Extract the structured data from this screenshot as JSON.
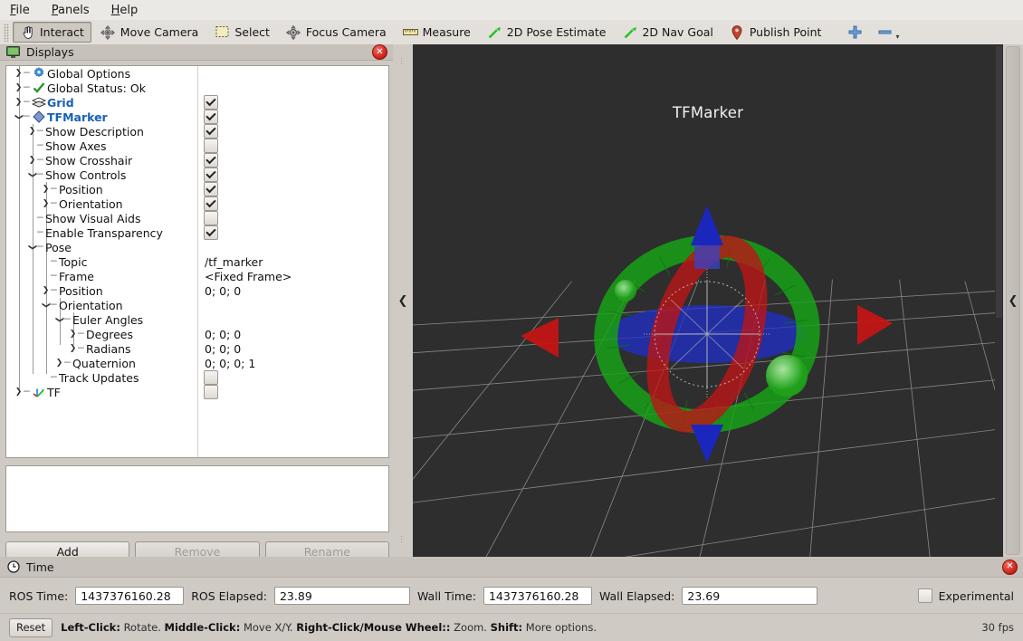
{
  "menubar": {
    "items": [
      {
        "name": "file",
        "label": "File",
        "mnemonic": "F"
      },
      {
        "name": "panels",
        "label": "Panels",
        "mnemonic": "P"
      },
      {
        "name": "help",
        "label": "Help",
        "mnemonic": "H"
      }
    ]
  },
  "toolbar": {
    "items": [
      {
        "name": "interact",
        "label": "Interact",
        "icon": "hand-cursor-icon",
        "active": true
      },
      {
        "name": "move-camera",
        "label": "Move Camera",
        "icon": "move-camera-icon",
        "active": false
      },
      {
        "name": "select",
        "label": "Select",
        "icon": "selection-rect-icon",
        "active": false
      },
      {
        "name": "focus-camera",
        "label": "Focus Camera",
        "icon": "focus-camera-icon",
        "active": false
      },
      {
        "name": "measure",
        "label": "Measure",
        "icon": "ruler-icon",
        "active": false
      },
      {
        "name": "2d-pose-estimate",
        "label": "2D Pose Estimate",
        "icon": "green-arrow-icon",
        "active": false
      },
      {
        "name": "2d-nav-goal",
        "label": "2D Nav Goal",
        "icon": "green-arrow-icon",
        "active": false
      },
      {
        "name": "publish-point",
        "label": "Publish Point",
        "icon": "map-pin-icon",
        "active": false
      }
    ],
    "add_tool_icon": "plus-icon",
    "remove_tool_icon": "minus-icon",
    "remove_tool_chevron": "chevron-down-icon"
  },
  "displays": {
    "title": "Displays",
    "close_icon": "close-icon",
    "panel_icon": "monitor-icon",
    "tree": [
      {
        "name": "global-options",
        "label": "Global Options",
        "indent": 0,
        "arrow": "collapsed",
        "icon": "gear-icon",
        "style": "normal",
        "check": null,
        "value": null
      },
      {
        "name": "global-status",
        "label": "Global Status: Ok",
        "indent": 0,
        "arrow": "collapsed",
        "icon": "check-icon",
        "style": "normal",
        "check": null,
        "value": null
      },
      {
        "name": "grid",
        "label": "Grid",
        "indent": 0,
        "arrow": "collapsed",
        "icon": "grid-icon",
        "style": "blue-bold",
        "check": true,
        "value": null
      },
      {
        "name": "tfmarker",
        "label": "TFMarker",
        "indent": 0,
        "arrow": "expanded",
        "icon": "diamond-icon",
        "style": "blue-bold",
        "check": true,
        "value": null
      },
      {
        "name": "show-description",
        "label": "Show Description",
        "indent": 1,
        "arrow": "collapsed",
        "icon": null,
        "style": "normal",
        "check": true,
        "value": null
      },
      {
        "name": "show-axes",
        "label": "Show Axes",
        "indent": 1,
        "arrow": "none",
        "icon": null,
        "style": "normal",
        "check": false,
        "value": null
      },
      {
        "name": "show-crosshair",
        "label": "Show Crosshair",
        "indent": 1,
        "arrow": "collapsed",
        "icon": null,
        "style": "normal",
        "check": true,
        "value": null
      },
      {
        "name": "show-controls",
        "label": "Show Controls",
        "indent": 1,
        "arrow": "expanded",
        "icon": null,
        "style": "normal",
        "check": true,
        "value": null
      },
      {
        "name": "position",
        "label": "Position",
        "indent": 2,
        "arrow": "collapsed",
        "icon": null,
        "style": "normal",
        "check": true,
        "value": null
      },
      {
        "name": "orientation",
        "label": "Orientation",
        "indent": 2,
        "arrow": "collapsed",
        "icon": null,
        "style": "normal",
        "check": true,
        "value": null
      },
      {
        "name": "show-visual-aids",
        "label": "Show Visual Aids",
        "indent": 1,
        "arrow": "none",
        "icon": null,
        "style": "normal",
        "check": false,
        "value": null
      },
      {
        "name": "enable-transparency",
        "label": "Enable Transparency",
        "indent": 1,
        "arrow": "none",
        "icon": null,
        "style": "normal",
        "check": true,
        "value": null
      },
      {
        "name": "pose",
        "label": "Pose",
        "indent": 1,
        "arrow": "expanded",
        "icon": null,
        "style": "normal",
        "check": null,
        "value": null
      },
      {
        "name": "topic",
        "label": "Topic",
        "indent": 2,
        "arrow": "none",
        "icon": null,
        "style": "normal",
        "check": null,
        "value": "/tf_marker"
      },
      {
        "name": "frame",
        "label": "Frame",
        "indent": 2,
        "arrow": "none",
        "icon": null,
        "style": "normal",
        "check": null,
        "value": "<Fixed Frame>"
      },
      {
        "name": "pose-position",
        "label": "Position",
        "indent": 2,
        "arrow": "collapsed",
        "icon": null,
        "style": "normal",
        "check": null,
        "value": "0; 0; 0"
      },
      {
        "name": "pose-orientation",
        "label": "Orientation",
        "indent": 2,
        "arrow": "expanded",
        "icon": null,
        "style": "normal",
        "check": null,
        "value": null
      },
      {
        "name": "euler-angles",
        "label": "Euler Angles",
        "indent": 3,
        "arrow": "expanded",
        "icon": null,
        "style": "normal",
        "check": null,
        "value": null
      },
      {
        "name": "degrees",
        "label": "Degrees",
        "indent": 4,
        "arrow": "collapsed",
        "icon": null,
        "style": "normal",
        "check": null,
        "value": "0; 0; 0"
      },
      {
        "name": "radians",
        "label": "Radians",
        "indent": 4,
        "arrow": "collapsed",
        "icon": null,
        "style": "normal",
        "check": null,
        "value": "0; 0; 0"
      },
      {
        "name": "quaternion",
        "label": "Quaternion",
        "indent": 3,
        "arrow": "collapsed",
        "icon": null,
        "style": "normal",
        "check": null,
        "value": "0; 0; 0; 1"
      },
      {
        "name": "track-updates",
        "label": "Track Updates",
        "indent": 2,
        "arrow": "none",
        "icon": null,
        "style": "normal",
        "check": false,
        "value": null
      },
      {
        "name": "tf",
        "label": "TF",
        "indent": 0,
        "arrow": "collapsed",
        "icon": "tf-axes-icon",
        "style": "normal",
        "check": false,
        "value": null
      }
    ],
    "buttons": [
      {
        "name": "add-button",
        "label": "Add",
        "disabled": false
      },
      {
        "name": "remove-button",
        "label": "Remove",
        "disabled": true
      },
      {
        "name": "rename-button",
        "label": "Rename",
        "disabled": true
      }
    ]
  },
  "viewport": {
    "marker_label": "TFMarker",
    "background_color": "#2e2e2e",
    "grid_color": "#a0a0a0"
  },
  "splitters": {
    "left_collapse_icon": "chevron-left-icon",
    "right_collapse_icon": "chevron-left-icon"
  },
  "time_panel": {
    "title": "Time",
    "clock_icon": "clock-icon",
    "close_icon": "close-icon",
    "fields": [
      {
        "name": "ros-time",
        "label": "ROS Time:",
        "value": "1437376160.28",
        "width": "w1"
      },
      {
        "name": "ros-elapsed",
        "label": "ROS Elapsed:",
        "value": "23.89",
        "width": "w2"
      },
      {
        "name": "wall-time",
        "label": "Wall Time:",
        "value": "1437376160.28",
        "width": "w1"
      },
      {
        "name": "wall-elapsed",
        "label": "Wall Elapsed:",
        "value": "23.69",
        "width": "w2"
      }
    ],
    "experimental_label": "Experimental",
    "experimental_checked": false
  },
  "statusbar": {
    "reset_label": "Reset",
    "hints": [
      {
        "bold": "Left-Click:",
        "normal": " Rotate."
      },
      {
        "bold": "Middle-Click:",
        "normal": " Move X/Y."
      },
      {
        "bold": "Right-Click/Mouse Wheel::",
        "normal": " Zoom."
      },
      {
        "bold": "Shift:",
        "normal": " More options."
      }
    ],
    "fps": "30 fps"
  }
}
